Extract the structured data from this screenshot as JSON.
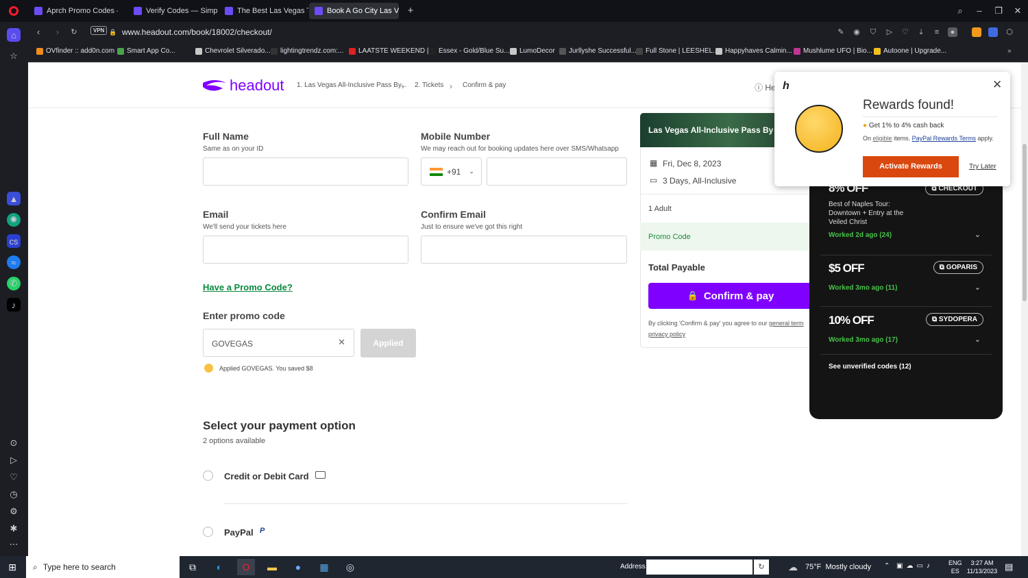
{
  "browser": {
    "tabs": [
      {
        "title": "Aprch Promo Codes – 15"
      },
      {
        "title": "Verify Codes — SimplyCo"
      },
      {
        "title": "The Best Las Vegas Tours"
      },
      {
        "title": "Book A Go City Las Vegas"
      }
    ],
    "url": "www.headout.com/book/18002/checkout/",
    "vpn": "VPN",
    "bookmarks": [
      "OVfinder :: add0n.com",
      "Smart App Co...",
      "Chevrolet Silverado...",
      "lightingtrendz.com:...",
      "LAATSTE WEEKEND |...",
      "Essex - Gold/Blue Su...",
      "LumoDecor",
      "Jurllyshe Successful...",
      "Full Stone | LEESHEL...",
      "Happyhaves Calmin...",
      "Mushlume UFO | Bio...",
      "Autoone | Upgrade..."
    ]
  },
  "header": {
    "brand": "headout",
    "crumbs": [
      "1. Las Vegas All-Inclusive Pass By...",
      "2. Tickets",
      "Confirm & pay"
    ],
    "help": "He"
  },
  "form": {
    "full_name_label": "Full Name",
    "full_name_hint": "Same as on your ID",
    "mobile_label": "Mobile Number",
    "mobile_hint": "We may reach out for booking updates here over SMS/Whatsapp",
    "country_code": "+91",
    "email_label": "Email",
    "email_hint": "We'll send your tickets here",
    "confirm_email_label": "Confirm Email",
    "confirm_email_hint": "Just to ensure we've got this right",
    "promo_link": "Have a Promo Code?",
    "enter_promo_label": "Enter promo code",
    "promo_value": "GOVEGAS",
    "applied_button": "Applied",
    "applied_msg": "Applied GOVEGAS. You saved $8"
  },
  "payment": {
    "title": "Select your payment option",
    "subtitle": "2 options available",
    "options": [
      "Credit or Debit Card",
      "PayPal"
    ]
  },
  "summary": {
    "title": "Las Vegas All-Inclusive Pass By",
    "date": "Fri, Dec 8, 2023",
    "duration": "3 Days, All-Inclusive",
    "guests": "1 Adult",
    "promo": "Promo Code",
    "total": "Total Payable",
    "pay_button": "Confirm & pay",
    "terms_prefix": "By clicking 'Confirm & pay' you agree to our",
    "terms_link": "general term",
    "privacy_link": "privacy policy"
  },
  "rewards": {
    "title": "Rewards found!",
    "cashback": "Get 1% to 4% cash back",
    "on": "On",
    "eligible": "eligible",
    "items": "items.",
    "terms": "PayPal Rewards Terms",
    "apply": "apply.",
    "activate": "Activate Rewards",
    "later": "Try Later"
  },
  "coupons": {
    "first": {
      "off": "8% OFF",
      "code": "CHECKOUT",
      "desc": "Best of Naples Tour: Downtown + Entry at the Veiled Christ",
      "worked": "Worked 2d ago (24)"
    },
    "list": [
      {
        "off": "$5 OFF",
        "code": "GOPARIS",
        "worked": "Worked 3mo ago (11)"
      },
      {
        "off": "10% OFF",
        "code": "SYDOPERA",
        "worked": "Worked 3mo ago (17)"
      }
    ],
    "unverified": "See unverified codes (12)"
  },
  "taskbar": {
    "search": "Type here to search",
    "address": "Address",
    "weather": "75°F  Mostly cloudy",
    "lang": "ENG",
    "locale": "ES",
    "time": "3:27 AM",
    "date": "11/13/2023"
  },
  "colors": {
    "brand": "#8000ff",
    "rewards_btn": "#d9480f",
    "honey_bg": "#141414"
  }
}
